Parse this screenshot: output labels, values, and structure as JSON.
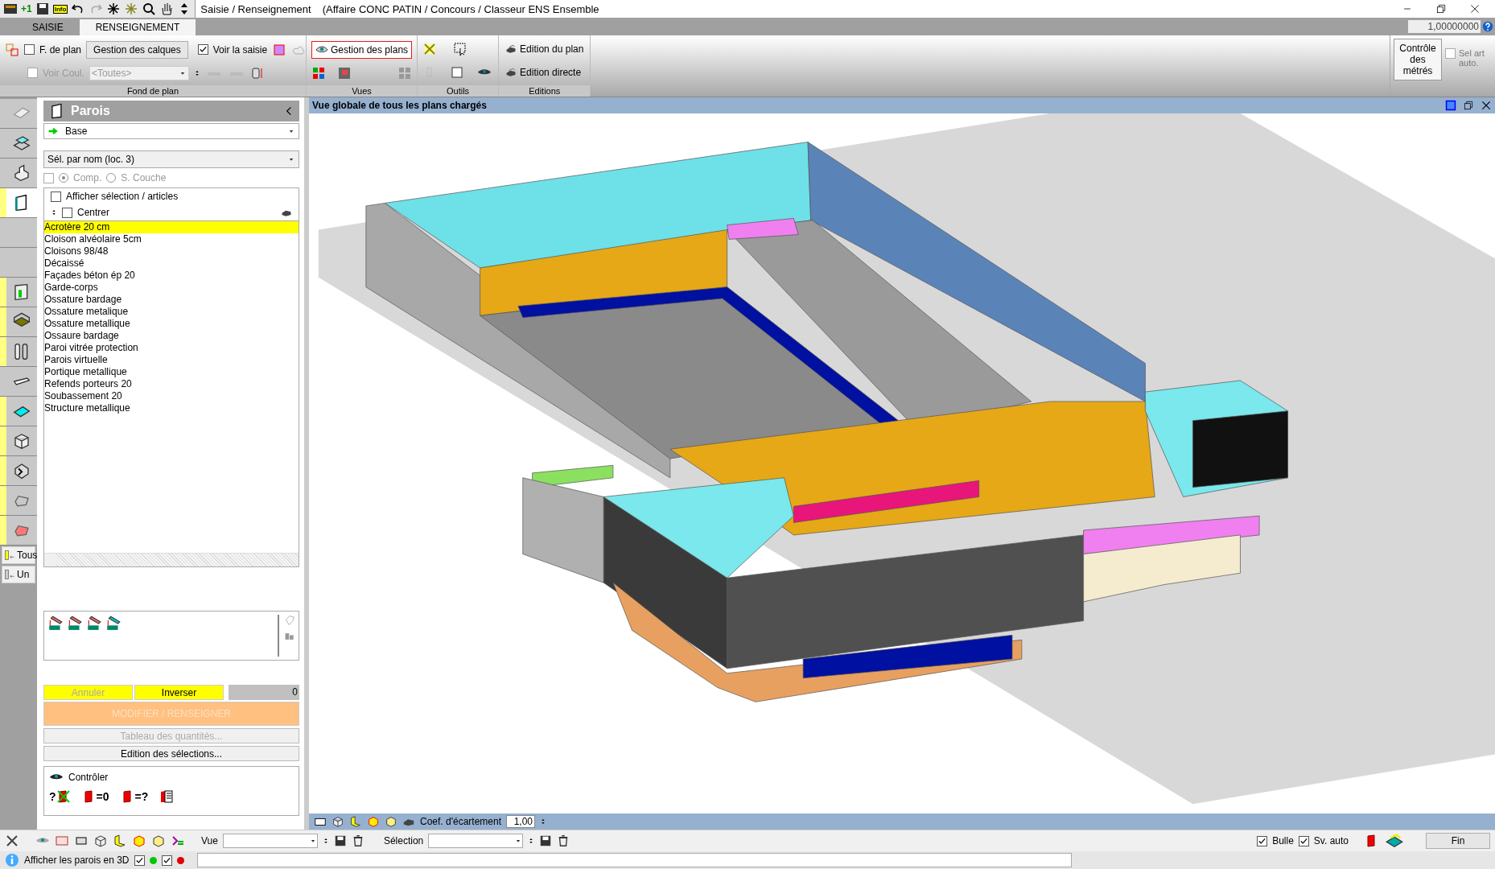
{
  "quick_toolbar": {
    "plus_label": "+1",
    "info_label": "Info"
  },
  "window": {
    "title": "Saisie / Renseignement",
    "subtitle": "(Affaire CONC PATIN / Concours / Classeur ENS Ensemble"
  },
  "tabs": [
    {
      "label": "SAISIE",
      "selected": false
    },
    {
      "label": "RENSEIGNEMENT",
      "selected": true
    }
  ],
  "scale_field": {
    "value": "1,00000000"
  },
  "ribbon": {
    "fond_de_plan": {
      "label": "Fond de plan",
      "f_de_plan": {
        "label": "F. de plan",
        "checked": false
      },
      "gestion_calques": "Gestion des calques",
      "voir_saisie": {
        "label": "Voir la saisie",
        "checked": true
      },
      "voir_coul": {
        "label": "Voir Coul.",
        "checked": false,
        "disabled": true
      },
      "couleur_dropdown": {
        "value": "<Toutes>",
        "disabled": true
      }
    },
    "vues": {
      "label": "Vues",
      "gestion_plans": {
        "label": "Gestion des plans",
        "highlighted": true
      }
    },
    "outils": {
      "label": "Outils"
    },
    "editions": {
      "label": "Editions",
      "buttons": [
        "Edition du plan",
        "Edition directe"
      ]
    },
    "controle_metres": "Contrôle des métrés",
    "sel_art_auto": {
      "label": "Sel art auto.",
      "checked": false,
      "disabled": true
    }
  },
  "rail": {
    "items": [
      {
        "flagged": false,
        "selected": false
      },
      {
        "flagged": false,
        "selected": false
      },
      {
        "flagged": false,
        "selected": false
      },
      {
        "flagged": true,
        "selected": true
      },
      {
        "flagged": false,
        "selected": false
      },
      {
        "flagged": false,
        "selected": false
      },
      {
        "flagged": true,
        "selected": false
      },
      {
        "flagged": true,
        "selected": false
      },
      {
        "flagged": true,
        "selected": false
      },
      {
        "flagged": false,
        "selected": false
      },
      {
        "flagged": true,
        "selected": false
      },
      {
        "flagged": true,
        "selected": false
      },
      {
        "flagged": true,
        "selected": false
      },
      {
        "flagged": true,
        "selected": false
      },
      {
        "flagged": true,
        "selected": false
      }
    ],
    "buttons": [
      "Tous",
      "Un"
    ]
  },
  "panel": {
    "title": "Parois",
    "base_dropdown": "Base",
    "selection_dropdown": "Sél. par nom (loc. 3)",
    "filter": {
      "checked": false,
      "disabled": true,
      "radios": [
        {
          "label": "Comp.",
          "selected": true
        },
        {
          "label": "S. Couche",
          "selected": false
        }
      ]
    },
    "afficher_selection": {
      "label": "Afficher sélection / articles",
      "checked": false
    },
    "centrer": {
      "label": "Centrer",
      "checked": false
    },
    "items": [
      {
        "label": "Acrotère 20 cm",
        "selected": true
      },
      {
        "label": "Cloison alvéolaire 5cm",
        "selected": false
      },
      {
        "label": "Cloisons 98/48",
        "selected": false
      },
      {
        "label": "Décaissé",
        "selected": false
      },
      {
        "label": "Façades béton ép 20",
        "selected": false
      },
      {
        "label": "Garde-corps",
        "selected": false
      },
      {
        "label": "Ossature bardage",
        "selected": false
      },
      {
        "label": "Ossature metalique",
        "selected": false
      },
      {
        "label": "Ossature metallique",
        "selected": false
      },
      {
        "label": "Ossaure bardage",
        "selected": false
      },
      {
        "label": "Paroi vitrée protection",
        "selected": false
      },
      {
        "label": "Parois virtuelle",
        "selected": false
      },
      {
        "label": "Portique metallique",
        "selected": false
      },
      {
        "label": "Refends porteurs 20",
        "selected": false
      },
      {
        "label": "Soubassement 20",
        "selected": false
      },
      {
        "label": "Structure metallique",
        "selected": false
      }
    ],
    "annuler": {
      "label": "Annuler",
      "disabled": true
    },
    "inverser": {
      "label": "Inverser",
      "disabled": false
    },
    "count": "0",
    "modifier": {
      "label": "MODIFIER / RENSEIGNER",
      "disabled": true
    },
    "tableau": {
      "label": "Tableau des quantités...",
      "disabled": true
    },
    "edition_selections": {
      "label": "Edition des sélections...",
      "disabled": false
    },
    "controler": {
      "label": "Contrôler",
      "marks": [
        "?",
        "=0",
        "=?"
      ]
    }
  },
  "viewport": {
    "title": "Vue globale de tous les plans chargés",
    "coef_label": "Coef. d'écartement",
    "coef_value": "1,00"
  },
  "bottom_bar": {
    "vue_label": "Vue",
    "selection_label": "Sélection",
    "bulle": {
      "label": "Bulle",
      "checked": true
    },
    "sv_auto": {
      "label": "Sv. auto",
      "checked": true
    },
    "fin": "Fin"
  },
  "status_bar": {
    "label": "Afficher les parois en 3D",
    "checks": [
      {
        "checked": true,
        "color": "#00c800"
      },
      {
        "checked": true,
        "color": "#e00000"
      }
    ]
  }
}
